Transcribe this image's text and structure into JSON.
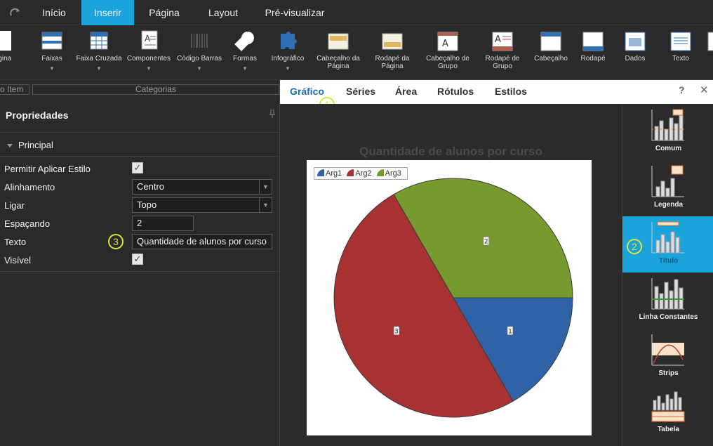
{
  "topbar": {
    "menu": [
      {
        "label": "Início"
      },
      {
        "label": "Inserir"
      },
      {
        "label": "Página"
      },
      {
        "label": "Layout"
      },
      {
        "label": "Pré-visualizar"
      }
    ]
  },
  "ribbon": {
    "items": [
      {
        "label": "ágina",
        "icon": "page-icon"
      },
      {
        "label": "Faixas",
        "icon": "bands-icon"
      },
      {
        "label": "Faixa Cruzada",
        "icon": "cross-band-icon"
      },
      {
        "label": "Componentes",
        "icon": "components-icon"
      },
      {
        "label": "Código Barras",
        "icon": "barcode-icon"
      },
      {
        "label": "Formas",
        "icon": "shapes-icon"
      },
      {
        "label": "Infográfico",
        "icon": "infographic-icon"
      },
      {
        "label": "Cabeçalho da Página",
        "icon": "page-header-icon"
      },
      {
        "label": "Rodapé da Página",
        "icon": "page-footer-icon"
      },
      {
        "label": "Cabeçalho de Grupo",
        "icon": "group-header-icon"
      },
      {
        "label": "Rodapé de Grupo",
        "icon": "group-footer-icon"
      },
      {
        "label": "Cabeçalho",
        "icon": "header-icon"
      },
      {
        "label": "Rodapé",
        "icon": "footer-icon"
      },
      {
        "label": "Dados",
        "icon": "data-icon"
      },
      {
        "label": "Texto",
        "icon": "text-icon"
      }
    ]
  },
  "left": {
    "search_a": "o Item",
    "search_b": "Categorias",
    "title": "Propriedades",
    "section": "Principal",
    "props": {
      "style_label": "Permitir Aplicar Estilo",
      "align_label": "Alinhamento",
      "align_value": "Centro",
      "dock_label": "Ligar",
      "dock_value": "Topo",
      "spacing_label": "Espaçando",
      "spacing_value": "2",
      "text_label": "Texto",
      "text_value": "Quantidade de alunos por curso",
      "visible_label": "Visível"
    },
    "badge": "3"
  },
  "dialog": {
    "tabs": [
      {
        "label": "Gráfico"
      },
      {
        "label": "Séries"
      },
      {
        "label": "Área"
      },
      {
        "label": "Rótulos"
      },
      {
        "label": "Estilos"
      }
    ],
    "help": "?",
    "close": "✕",
    "badge_tab": "1",
    "badge_side": "2",
    "side_items": [
      {
        "label": "Comum"
      },
      {
        "label": "Legenda"
      },
      {
        "label": "Título"
      },
      {
        "label": "Linha Constantes"
      },
      {
        "label": "Strips"
      },
      {
        "label": "Tabela"
      }
    ]
  },
  "chart_data": {
    "type": "pie",
    "title": "Quantidade de alunos por curso",
    "categories": [
      "Arg1",
      "Arg2",
      "Arg3"
    ],
    "values": [
      1,
      3,
      2
    ],
    "colors": [
      "#2f63a5",
      "#a83232",
      "#779a2f"
    ],
    "legend": "top-left"
  },
  "colors": {
    "accent": "#1ba3dc",
    "badge": "#d8e43b"
  }
}
